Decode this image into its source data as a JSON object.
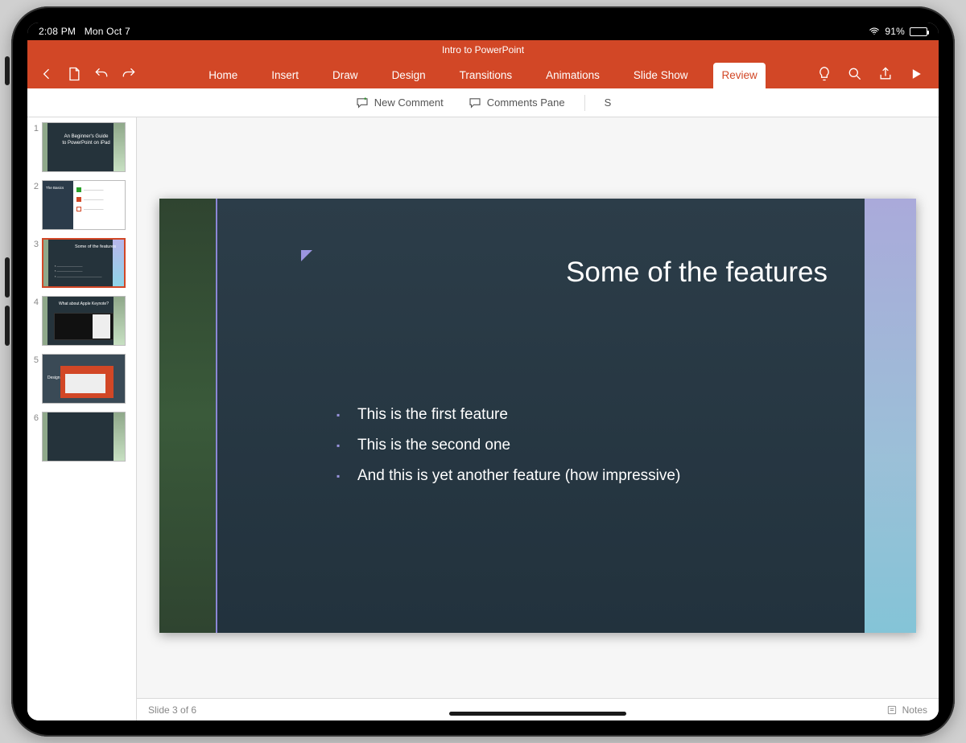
{
  "status": {
    "time": "2:08 PM",
    "date": "Mon Oct 7",
    "battery_pct": "91%"
  },
  "doc": {
    "title": "Intro to PowerPoint"
  },
  "tabs": {
    "home": "Home",
    "insert": "Insert",
    "draw": "Draw",
    "design": "Design",
    "transitions": "Transitions",
    "animations": "Animations",
    "slideshow": "Slide Show",
    "review": "Review",
    "active": "review"
  },
  "review_cmds": {
    "new_comment": "New Comment",
    "comments_pane": "Comments Pane",
    "extra": "S"
  },
  "slide": {
    "title": "Some of the features",
    "bullets": [
      "This is the first feature",
      "This is the second one",
      "And this is yet another feature (how impressive)"
    ]
  },
  "thumbs": {
    "count": 6,
    "selected": 3,
    "titles": {
      "1": "An Beginner's Guide to PowerPoint on iPad",
      "2": "The Basics",
      "3": "Some of the features",
      "4": "What about Apple Keynote?",
      "5": "Design",
      "6": ""
    }
  },
  "footer": {
    "slide_counter": "Slide 3 of 6",
    "notes": "Notes"
  }
}
